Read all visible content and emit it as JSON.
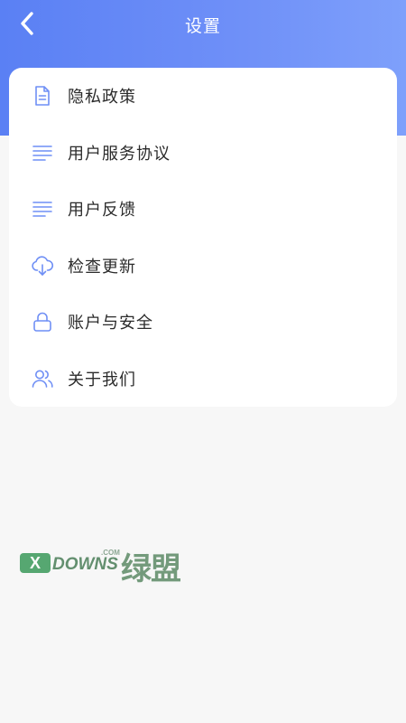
{
  "header": {
    "title": "设置",
    "back_icon": "chevron-left-icon",
    "gradient_start": "#5a80f4",
    "gradient_end": "#7ea0fb"
  },
  "menu": {
    "items": [
      {
        "label": "隐私政策",
        "icon": "document-icon"
      },
      {
        "label": "用户服务协议",
        "icon": "text-lines-icon"
      },
      {
        "label": "用户反馈",
        "icon": "text-lines-icon"
      },
      {
        "label": "检查更新",
        "icon": "cloud-download-icon"
      },
      {
        "label": "账户与安全",
        "icon": "lock-icon"
      },
      {
        "label": "关于我们",
        "icon": "users-icon"
      }
    ],
    "icon_color": "#6f8ff5"
  },
  "watermark": {
    "x": "X",
    "brand": "DOWNS",
    "domain": ".COM",
    "cn": "绿盟"
  }
}
